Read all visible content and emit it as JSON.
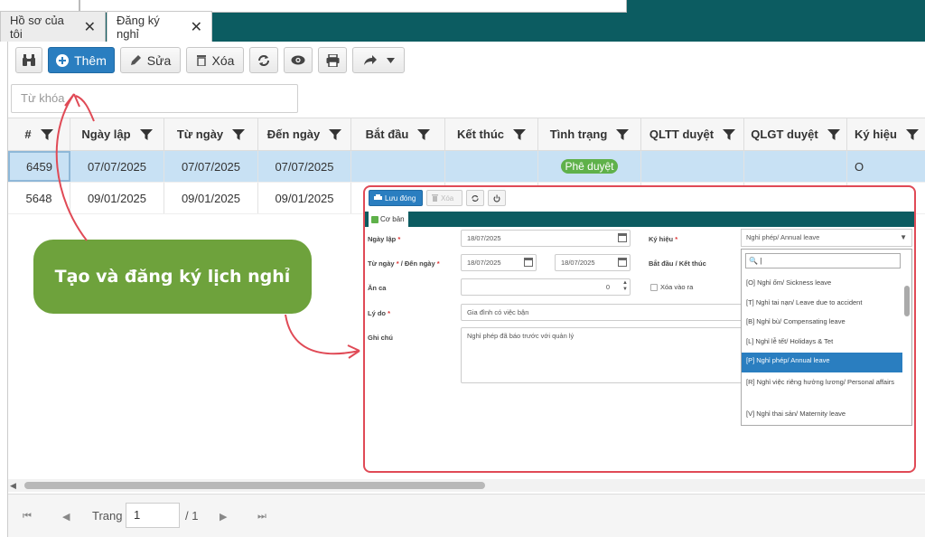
{
  "tabs": [
    {
      "label": "Hồ sơ của tôi",
      "close": "✕"
    },
    {
      "label": "Đăng ký nghỉ",
      "close": "✕"
    }
  ],
  "toolbar": {
    "add_label": "Thêm",
    "edit_label": "Sửa",
    "delete_label": "Xóa"
  },
  "search": {
    "placeholder": "Từ khóa"
  },
  "grid": {
    "columns": [
      "#",
      "Ngày lập",
      "Từ ngày",
      "Đến ngày",
      "Bắt đầu",
      "Kết thúc",
      "Tình trạng",
      "QLTT duyệt",
      "QLGT duyệt",
      "Ký hiệu"
    ],
    "rows": [
      {
        "id": "6459",
        "created": "07/07/2025",
        "from": "07/07/2025",
        "to": "07/07/2025",
        "start": "",
        "end": "",
        "status": "Phê duyệt",
        "qltt": "",
        "qlgt": "",
        "code": "O"
      },
      {
        "id": "5648",
        "created": "09/01/2025",
        "from": "09/01/2025",
        "to": "09/01/2025",
        "start": "",
        "end": "",
        "status": "",
        "qltt": "",
        "qlgt": "",
        "code": ""
      }
    ]
  },
  "pager": {
    "label": "Trang",
    "page": "1",
    "total": "/ 1"
  },
  "callout": {
    "text": "Tạo và đăng ký lịch nghỉ"
  },
  "form": {
    "save_label": "Lưu đóng",
    "delete_label": "Xóa",
    "tab_label": "Cơ bản",
    "created_label": "Ngày lập",
    "created_value": "18/07/2025",
    "range_label_a": "Từ ngày",
    "range_label_b": " / Đến ngày",
    "from_value": "18/07/2025",
    "to_value": "18/07/2025",
    "meal_label": "Ăn ca",
    "meal_value": "0",
    "reason_label": "Lý do",
    "reason_value": "Gia đình có việc bận",
    "note_label": "Ghi chú",
    "note_value": "Nghỉ phép đã báo trước với quản lý",
    "code_label": "Ký hiệu",
    "time_label": "Bắt đầu / Kết thúc",
    "inout_label": "Xóa vào ra",
    "code_selected": "Nghỉ phép/ Annual leave",
    "dropdown_search": "|",
    "options": [
      "[O] Nghỉ ốm/ Sickness leave",
      "[T] Nghỉ tai nạn/ Leave due to accident",
      "[B] Nghỉ bù/ Compensating leave",
      "[L] Nghỉ lễ tết/ Holidays & Tet",
      "[P] Nghỉ phép/ Annual leave",
      "[R] Nghỉ việc riêng hưởng lương/ Personal affairs",
      "[V] Nghỉ thai sản/ Maternity leave"
    ],
    "selected_option_index": 4
  },
  "colors": {
    "teal": "#0c5c61",
    "primary": "#2a7ec0",
    "green": "#6ea23c",
    "red_annotation": "#e04a56",
    "selected_row": "#c8e1f4"
  }
}
